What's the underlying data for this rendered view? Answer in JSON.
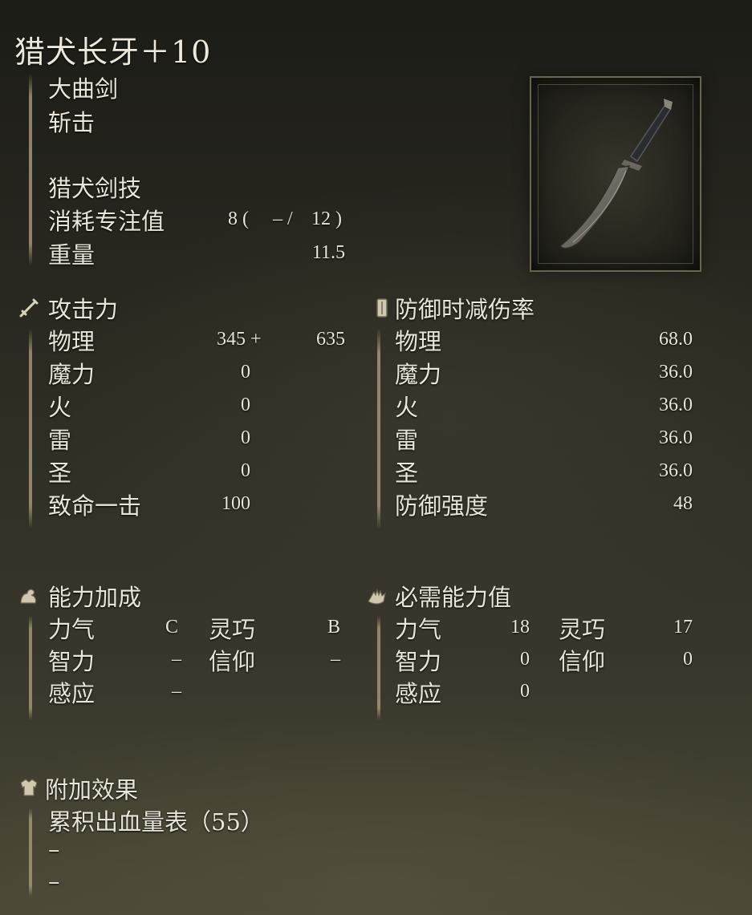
{
  "weapon": {
    "name": "猎犬长牙＋10",
    "type": "大曲剑",
    "damage_type": "斩击",
    "skill": "猎犬剑技",
    "fp_cost_label": "消耗专注值",
    "fp_cost_open": "8 (",
    "fp_cost_mid": "– /",
    "fp_cost_close": "12 )",
    "weight_label": "重量",
    "weight_value": "11.5"
  },
  "attack": {
    "heading": "攻击力",
    "rows": [
      {
        "label": "物理",
        "base": "345 +",
        "bonus": "635"
      },
      {
        "label": "魔力",
        "base": "0"
      },
      {
        "label": "火",
        "base": "0"
      },
      {
        "label": "雷",
        "base": "0"
      },
      {
        "label": "圣",
        "base": "0"
      },
      {
        "label": "致命一击",
        "base": "100"
      }
    ]
  },
  "guard": {
    "heading": "防御时减伤率",
    "rows": [
      {
        "label": "物理",
        "value": "68.0"
      },
      {
        "label": "魔力",
        "value": "36.0"
      },
      {
        "label": "火",
        "value": "36.0"
      },
      {
        "label": "雷",
        "value": "36.0"
      },
      {
        "label": "圣",
        "value": "36.0"
      },
      {
        "label": "防御强度",
        "value": "48"
      }
    ]
  },
  "scaling": {
    "heading": "能力加成",
    "str_label": "力气",
    "str": "C",
    "dex_label": "灵巧",
    "dex": "B",
    "int_label": "智力",
    "int": "–",
    "fai_label": "信仰",
    "fai": "–",
    "arc_label": "感应",
    "arc": "–"
  },
  "requirements": {
    "heading": "必需能力值",
    "str_label": "力气",
    "str": "18",
    "dex_label": "灵巧",
    "dex": "17",
    "int_label": "智力",
    "int": "0",
    "fai_label": "信仰",
    "fai": "0",
    "arc_label": "感应",
    "arc": "0"
  },
  "effects": {
    "heading": "附加效果",
    "items": [
      "累积出血量表（55）",
      "–",
      "–"
    ]
  },
  "icons": {
    "attack": "sword-icon",
    "guard": "shield-icon",
    "scaling": "flexed-arm-icon",
    "requirements": "hand-icon",
    "effects": "armor-icon"
  }
}
